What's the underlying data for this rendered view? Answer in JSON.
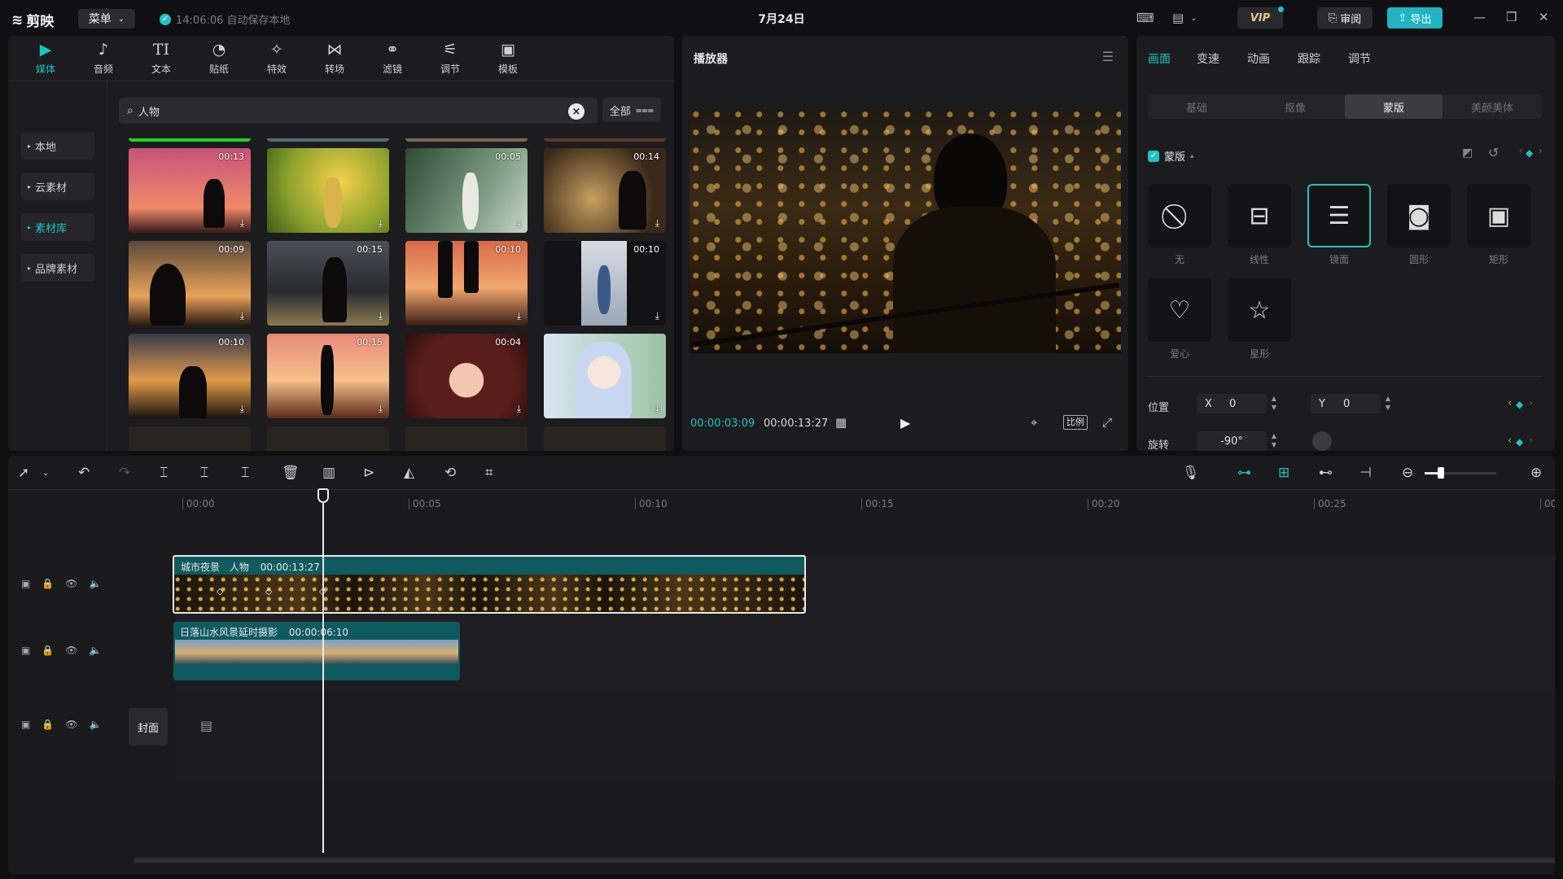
{
  "app": {
    "logo_text": "剪映",
    "menu_label": "菜单",
    "save_status": "14:06:06 自动保存本地",
    "project_title": "7月24日",
    "vip_label": "VIP",
    "review_label": "审阅",
    "export_label": "导出",
    "accent_color": "#1fc3c3"
  },
  "media_tabs": [
    {
      "label": "媒体",
      "icon": "media-icon",
      "active": true
    },
    {
      "label": "音频",
      "icon": "audio-icon"
    },
    {
      "label": "文本",
      "icon": "text-icon"
    },
    {
      "label": "贴纸",
      "icon": "sticker-icon"
    },
    {
      "label": "特效",
      "icon": "effects-icon"
    },
    {
      "label": "转场",
      "icon": "transition-icon"
    },
    {
      "label": "滤镜",
      "icon": "filter-icon"
    },
    {
      "label": "调节",
      "icon": "adjust-icon"
    },
    {
      "label": "模板",
      "icon": "template-icon"
    }
  ],
  "side_nav": [
    {
      "label": "本地"
    },
    {
      "label": "云素材"
    },
    {
      "label": "素材库",
      "active": true
    },
    {
      "label": "品牌素材"
    }
  ],
  "search": {
    "value": "人物",
    "filter_label": "全部"
  },
  "thumbnails": [
    {
      "duration": "00:13"
    },
    {
      "duration": ""
    },
    {
      "duration": "00:05"
    },
    {
      "duration": "00:14"
    },
    {
      "duration": "00:09"
    },
    {
      "duration": "00:15"
    },
    {
      "duration": "00:10"
    },
    {
      "duration": "00:10"
    },
    {
      "duration": "00:10"
    },
    {
      "duration": "00:15"
    },
    {
      "duration": "00:04"
    },
    {
      "duration": ""
    }
  ],
  "player": {
    "title": "播放器",
    "current_time": "00:00:03:09",
    "total_time": "00:00:13:27",
    "ratio_label": "比例"
  },
  "props": {
    "tabs": [
      "画面",
      "变速",
      "动画",
      "跟踪",
      "调节"
    ],
    "sub_tabs": [
      "基础",
      "抠像",
      "蒙版",
      "美颜美体"
    ],
    "mask_title": "蒙版",
    "masks": [
      {
        "label": "无",
        "icon": "none-icon"
      },
      {
        "label": "线性",
        "icon": "linear-icon"
      },
      {
        "label": "镜面",
        "icon": "mirror-icon",
        "selected": true
      },
      {
        "label": "圆形",
        "icon": "circle-icon"
      },
      {
        "label": "矩形",
        "icon": "rectangle-icon"
      },
      {
        "label": "爱心",
        "icon": "heart-icon"
      },
      {
        "label": "星形",
        "icon": "star-icon"
      }
    ],
    "position_label": "位置",
    "x_label": "X",
    "x_value": "0",
    "y_label": "Y",
    "y_value": "0",
    "rotate_label": "旋转",
    "rotate_value": "-90°"
  },
  "timeline": {
    "ruler_ticks": [
      "00:00",
      "00:05",
      "00:10",
      "00:15",
      "00:20",
      "00:25",
      "00:"
    ],
    "clip_main": {
      "name": "城市夜景",
      "tag": "人物",
      "duration": "00:00:13:27"
    },
    "clip_overlay": {
      "name": "日落山水风景延时摄影",
      "duration": "00:00:06:10"
    },
    "cover_label": "封面"
  }
}
